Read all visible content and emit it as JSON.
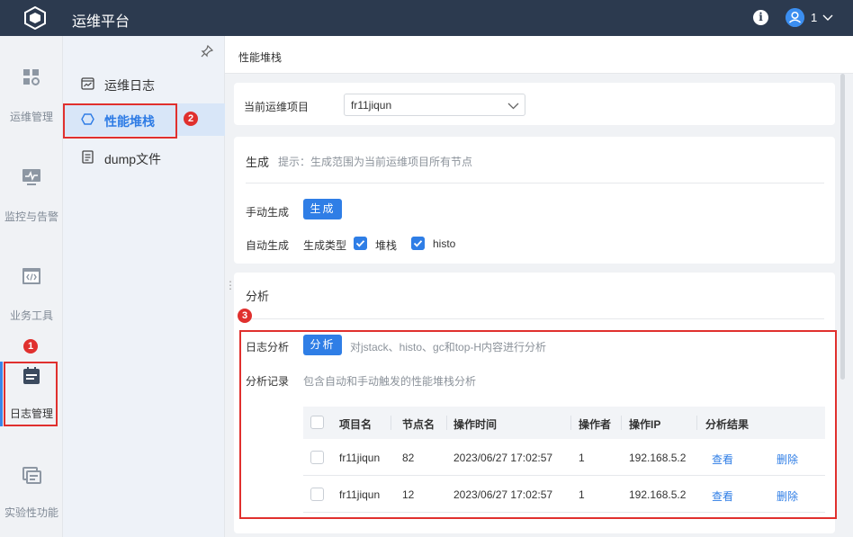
{
  "app": {
    "title": "运维平台"
  },
  "header": {
    "user_name": "1"
  },
  "rail": {
    "items": [
      {
        "label": "运维管理",
        "icon": "grid-icon"
      },
      {
        "label": "监控与告警",
        "icon": "monitor-icon"
      },
      {
        "label": "业务工具",
        "icon": "code-icon"
      },
      {
        "label": "日志管理",
        "icon": "log-icon"
      },
      {
        "label": "实验性功能",
        "icon": "experiment-icon"
      }
    ]
  },
  "subnav": {
    "items": [
      {
        "label": "运维日志",
        "icon": "calendar-chart-icon"
      },
      {
        "label": "性能堆栈",
        "icon": "hexagon-icon"
      },
      {
        "label": "dump文件",
        "icon": "document-icon"
      }
    ]
  },
  "annotations": {
    "b1": "1",
    "b2": "2",
    "b3": "3"
  },
  "main": {
    "breadcrumb": "性能堆栈",
    "project_label": "当前运维项目",
    "project_value": "fr11jiqun",
    "generate": {
      "title": "生成",
      "hint": "提示：生成范围为当前运维项目所有节点",
      "manual_label": "手动生成",
      "manual_button": "生成",
      "auto_label": "自动生成",
      "type_label": "生成类型",
      "opt1": "堆栈",
      "opt2": "histo"
    },
    "analyze": {
      "title": "分析",
      "log_label": "日志分析",
      "log_button": "分析",
      "log_hint": "对jstack、histo、gc和top-H内容进行分析",
      "record_label": "分析记录",
      "record_hint": "包含自动和手动触发的性能堆栈分析"
    },
    "table": {
      "columns": [
        "项目名",
        "节点名",
        "操作时间",
        "操作者",
        "操作IP",
        "分析结果"
      ],
      "rows": [
        {
          "project": "fr11jiqun",
          "node": "82",
          "time": "2023/06/27 17:02:57",
          "operator": "1",
          "ip": "192.168.5.2",
          "view": "查看",
          "delete": "删除"
        },
        {
          "project": "fr11jiqun",
          "node": "12",
          "time": "2023/06/27 17:02:57",
          "operator": "1",
          "ip": "192.168.5.2",
          "view": "查看",
          "delete": "删除"
        }
      ]
    }
  },
  "colors": {
    "topbar": "#2c3a4f",
    "accent": "#2f7ee6",
    "annotation": "#e0302e"
  }
}
